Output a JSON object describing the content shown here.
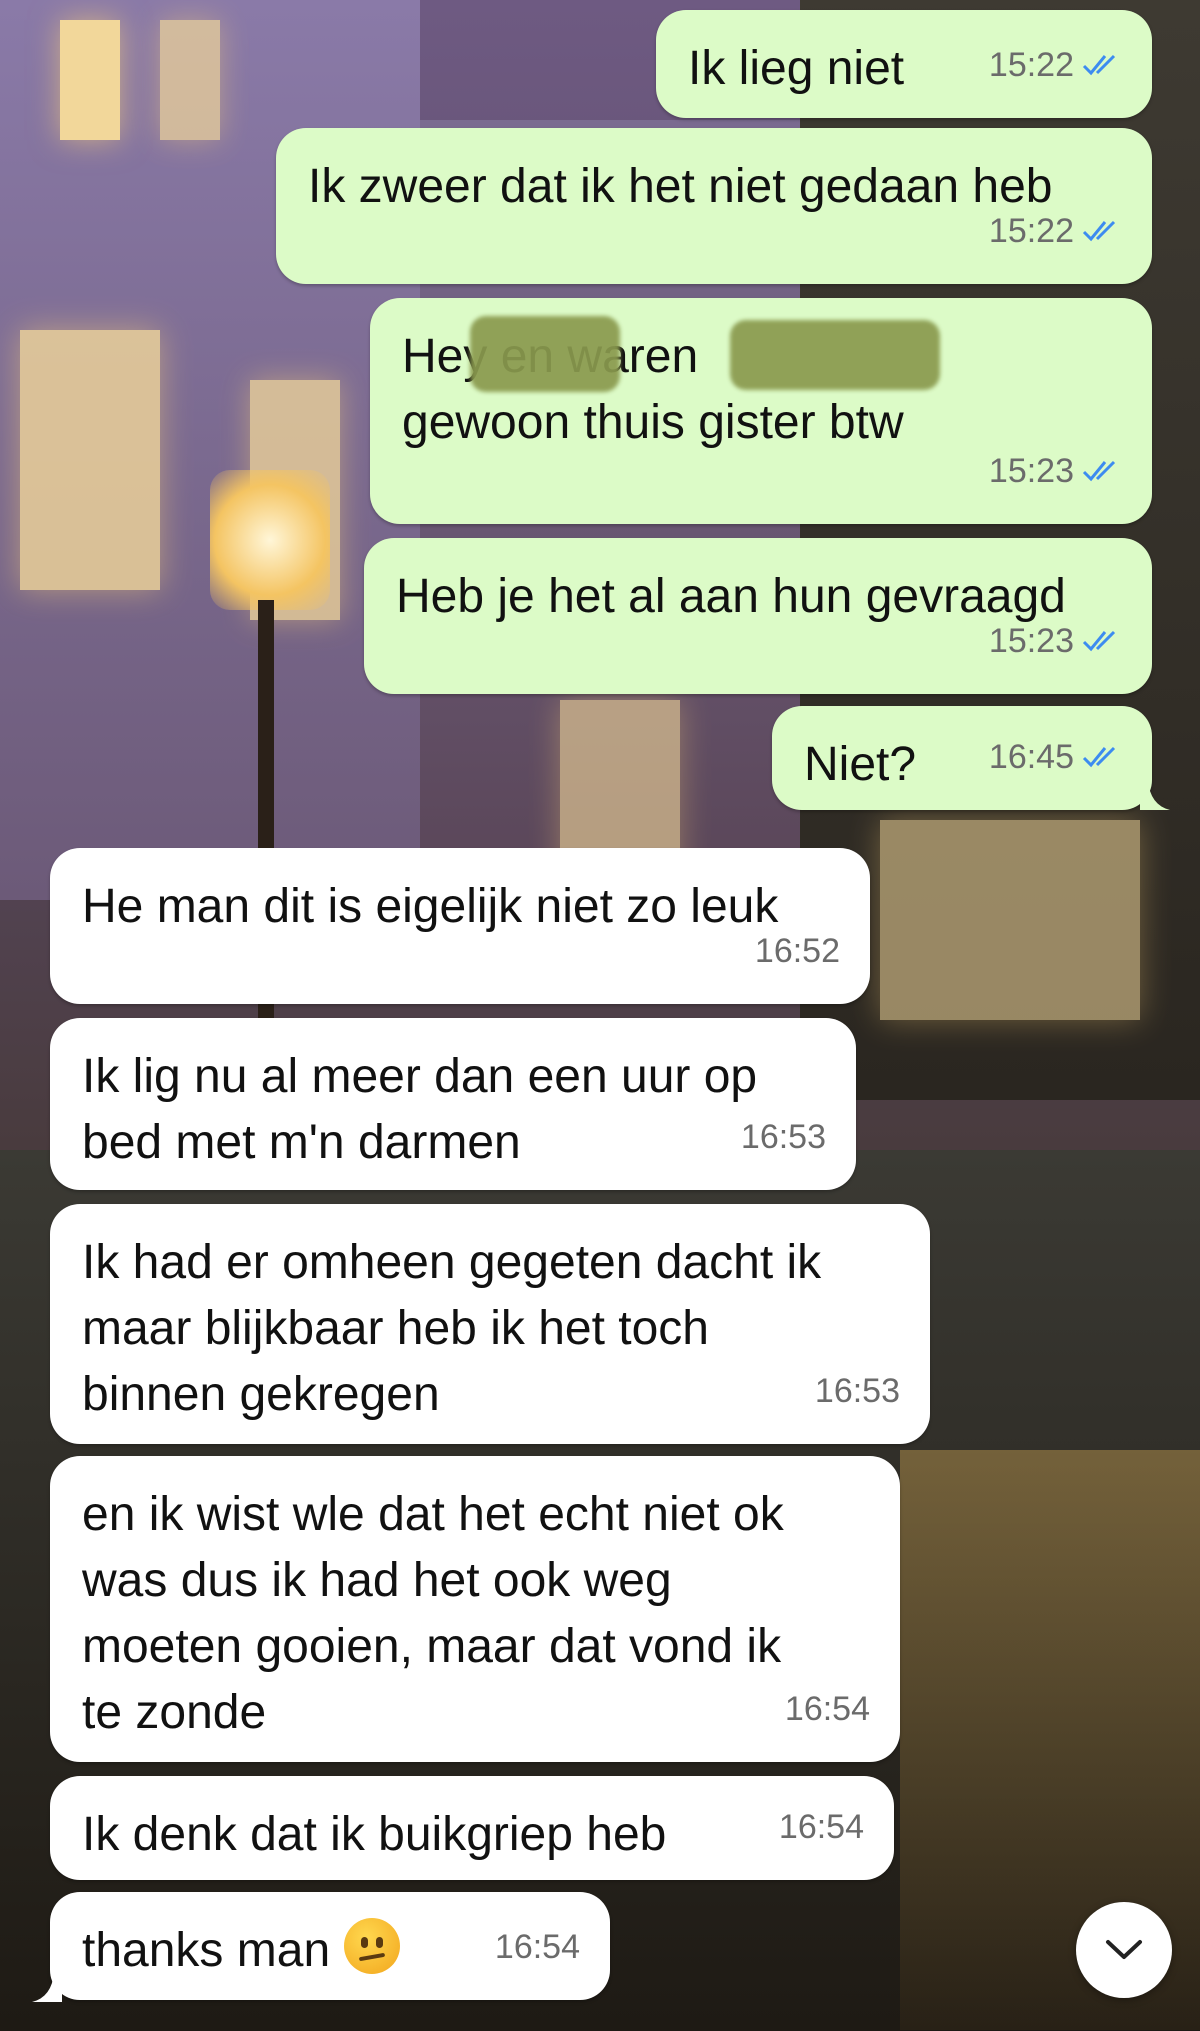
{
  "chat": {
    "messages": [
      {
        "dir": "out",
        "text": "Ik lieg niet",
        "time": "15:22"
      },
      {
        "dir": "out",
        "text": "Ik zweer dat ik het niet gedaan heb",
        "time": "15:22"
      },
      {
        "dir": "out",
        "text": "Hey         en                    waren\ngewoon thuis gister btw",
        "time": "15:23"
      },
      {
        "dir": "out",
        "text": "Heb je het al aan hun gevraagd",
        "time": "15:23"
      },
      {
        "dir": "out",
        "text": "Niet?",
        "time": "16:45"
      },
      {
        "dir": "in",
        "text": "He man dit is eigelijk niet zo leuk",
        "time": "16:52"
      },
      {
        "dir": "in",
        "text": "Ik lig nu al meer dan een uur op\nbed met m'n darmen",
        "time": "16:53"
      },
      {
        "dir": "in",
        "text": "Ik had er omheen gegeten dacht ik\nmaar blijkbaar heb ik het toch\nbinnen gekregen",
        "time": "16:53"
      },
      {
        "dir": "in",
        "text": "en ik wist wle dat het echt niet ok\nwas dus ik had het ook weg\nmoeten gooien, maar dat vond ik\nte zonde",
        "time": "16:54"
      },
      {
        "dir": "in",
        "text": "Ik denk dat ik buikgriep heb",
        "time": "16:54"
      },
      {
        "dir": "in",
        "text": "thanks man",
        "time": "16:54",
        "emoji": "confused-face-emoji"
      }
    ],
    "read_receipt_color": "#3d8cf0",
    "outgoing_bubble_color": "#dcfbc7",
    "incoming_bubble_color": "#ffffff",
    "scroll_button_icon": "chevron-down-icon"
  }
}
